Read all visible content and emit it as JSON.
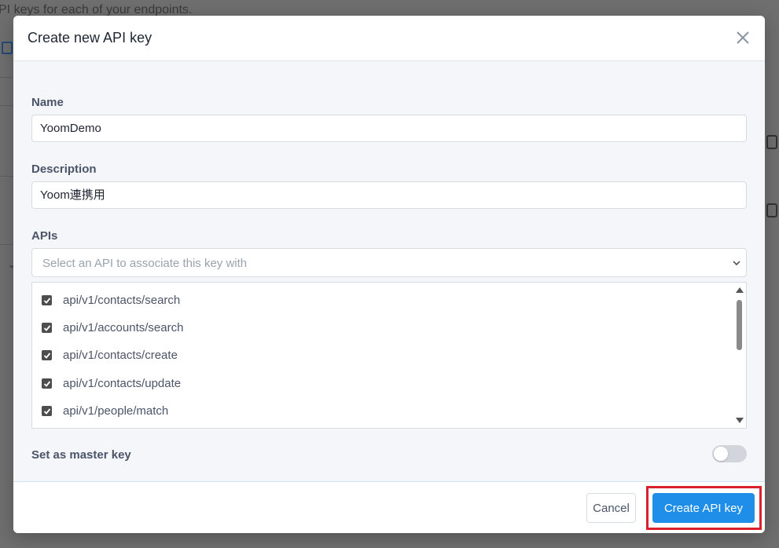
{
  "background": {
    "partial_text": "PI keys for each of your endpoints."
  },
  "modal": {
    "title": "Create new API key",
    "close_icon": "close-icon",
    "name": {
      "label": "Name",
      "value": "YoomDemo"
    },
    "description": {
      "label": "Description",
      "value": "Yoom連携用"
    },
    "apis": {
      "label": "APIs",
      "placeholder": "Select an API to associate this key with",
      "items": [
        {
          "label": "api/v1/contacts/search",
          "checked": true
        },
        {
          "label": "api/v1/accounts/search",
          "checked": true
        },
        {
          "label": "api/v1/contacts/create",
          "checked": true
        },
        {
          "label": "api/v1/contacts/update",
          "checked": true
        },
        {
          "label": "api/v1/people/match",
          "checked": true
        }
      ]
    },
    "master_key": {
      "label": "Set as master key",
      "enabled": false
    },
    "footer": {
      "cancel_label": "Cancel",
      "create_label": "Create API key"
    }
  },
  "colors": {
    "primary": "#1f8ee8",
    "highlight": "#d8212b"
  }
}
